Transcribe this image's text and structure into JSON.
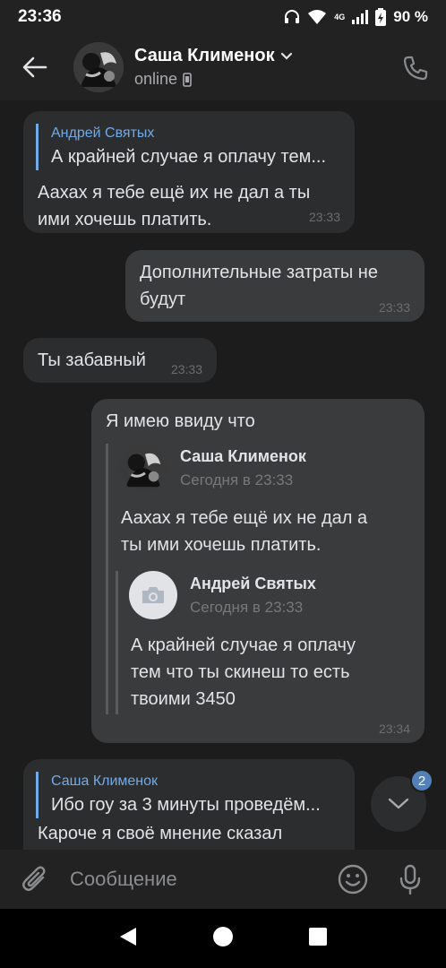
{
  "status_bar": {
    "time": "23:36",
    "network": "4G",
    "battery": "90 %"
  },
  "header": {
    "name": "Саша Клименок",
    "status": "online",
    "icons": {
      "back": "arrow-left-icon",
      "chevron": "chevron-down-icon",
      "phone": "phone-icon",
      "device": "mobile-device-icon"
    }
  },
  "messages": [
    {
      "direction": "in",
      "reply_to": {
        "name": "Андрей Святых",
        "text": "А крайней случае я оплачу тем..."
      },
      "text_lines": [
        "Аахах я тебе ещё их не дал а ты",
        "ими хочешь платить."
      ],
      "time": "23:33"
    },
    {
      "direction": "out",
      "text_lines": [
        "Дополнительные затраты не",
        "будут"
      ],
      "time": "23:33"
    },
    {
      "direction": "in",
      "text": "Ты забавный",
      "time": "23:33"
    },
    {
      "direction": "out",
      "text": "Я имею ввиду что",
      "forwarded": {
        "name": "Саша Клименок",
        "date": "Сегодня в 23:33",
        "text_lines": [
          "Аахах я тебе ещё их не дал а",
          "ты ими хочешь платить."
        ],
        "nested": {
          "name": "Андрей Святых",
          "date": "Сегодня в 23:33",
          "text_lines": [
            "А крайней случае я оплачу",
            "тем что ты скинеш то есть",
            "твоими 3450"
          ]
        }
      },
      "time": "23:34"
    },
    {
      "direction": "in",
      "reply_to": {
        "name": "Саша Клименок",
        "text": "Ибо гоу за 3 минуты проведём..."
      },
      "text": "Кароче я своё мнение сказал"
    }
  ],
  "scroll_button": {
    "unread_count": "2"
  },
  "composer": {
    "placeholder": "Сообщение"
  },
  "colors": {
    "accent": "#71aaeb",
    "bubble_in": "#2c2d2e",
    "bubble_out": "#3a3b3c",
    "badge": "#5181b8"
  }
}
